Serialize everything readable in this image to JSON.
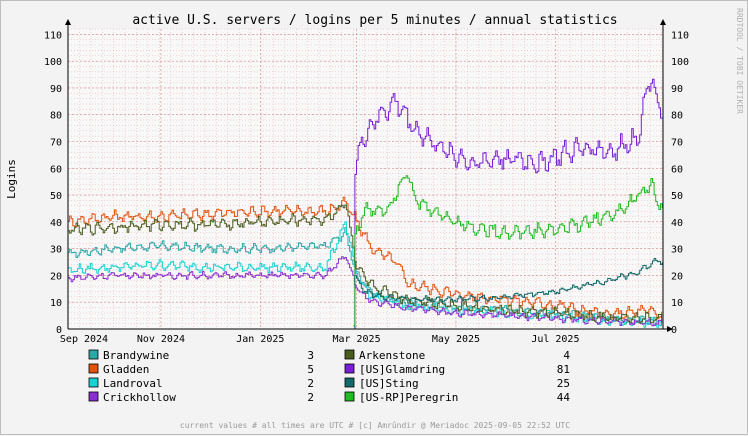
{
  "chart_data": {
    "type": "line",
    "title": "active U.S. servers / logins per 5 minutes / annual statistics",
    "ylabel": "Logins",
    "right_label": "RRDTOOL / TOBI OETIKER",
    "footer": "current values # all times are UTC # [c] Amrûndir @ Meriadoc 2025-09-05 22:52 UTC",
    "ylim": [
      0,
      112
    ],
    "y_ticks": [
      0,
      10,
      20,
      30,
      40,
      50,
      60,
      70,
      80,
      90,
      100,
      110
    ],
    "x_range": [
      "2024-09-05",
      "2025-09-05"
    ],
    "x_ticks": [
      {
        "date": "2024-09-01",
        "label": "Sep 2024"
      },
      {
        "date": "2024-11-01",
        "label": "Nov 2024"
      },
      {
        "date": "2025-01-01",
        "label": "Jan 2025"
      },
      {
        "date": "2025-03-01",
        "label": "Mar 2025"
      },
      {
        "date": "2025-05-01",
        "label": "May 2025"
      },
      {
        "date": "2025-07-01",
        "label": "Jul 2025"
      }
    ],
    "grid": true,
    "legend_position": "bottom",
    "series": [
      {
        "name": "Brandywine",
        "current": "3",
        "color": "#2aa7a7",
        "points": [
          [
            "2024-09-05",
            28
          ],
          [
            "2024-10-01",
            30
          ],
          [
            "2024-11-01",
            31
          ],
          [
            "2024-12-01",
            30
          ],
          [
            "2025-01-01",
            30
          ],
          [
            "2025-02-10",
            31
          ],
          [
            "2025-02-22",
            36
          ],
          [
            "2025-03-01",
            20
          ],
          [
            "2025-03-10",
            14
          ],
          [
            "2025-03-20",
            11
          ],
          [
            "2025-04-01",
            9
          ],
          [
            "2025-05-01",
            8
          ],
          [
            "2025-06-01",
            7
          ],
          [
            "2025-07-01",
            6
          ],
          [
            "2025-08-01",
            4
          ],
          [
            "2025-09-05",
            3
          ]
        ]
      },
      {
        "name": "Gladden",
        "current": "5",
        "color": "#e2530e",
        "points": [
          [
            "2024-09-05",
            40
          ],
          [
            "2024-10-01",
            42
          ],
          [
            "2024-11-01",
            42
          ],
          [
            "2024-12-01",
            43
          ],
          [
            "2025-01-01",
            44
          ],
          [
            "2025-02-10",
            44
          ],
          [
            "2025-02-22",
            47
          ],
          [
            "2025-03-01",
            40
          ],
          [
            "2025-03-10",
            30
          ],
          [
            "2025-03-25",
            25
          ],
          [
            "2025-04-01",
            17
          ],
          [
            "2025-05-01",
            13
          ],
          [
            "2025-06-01",
            11
          ],
          [
            "2025-07-01",
            9
          ],
          [
            "2025-08-01",
            5
          ],
          [
            "2025-08-25",
            7
          ],
          [
            "2025-09-05",
            5
          ]
        ]
      },
      {
        "name": "Landroval",
        "current": "2",
        "color": "#16d2d2",
        "points": [
          [
            "2024-09-05",
            22
          ],
          [
            "2024-10-01",
            23
          ],
          [
            "2024-11-01",
            24
          ],
          [
            "2024-12-01",
            23
          ],
          [
            "2025-01-01",
            23
          ],
          [
            "2025-02-10",
            23
          ],
          [
            "2025-02-22",
            40
          ],
          [
            "2025-03-01",
            19
          ],
          [
            "2025-03-10",
            12
          ],
          [
            "2025-04-01",
            9
          ],
          [
            "2025-05-01",
            7
          ],
          [
            "2025-06-01",
            6
          ],
          [
            "2025-07-01",
            5
          ],
          [
            "2025-08-01",
            3
          ],
          [
            "2025-09-05",
            2
          ]
        ]
      },
      {
        "name": "Crickhollow",
        "current": "2",
        "color": "#8b2fd0",
        "points": [
          [
            "2024-09-05",
            19
          ],
          [
            "2024-10-01",
            20
          ],
          [
            "2024-11-01",
            20
          ],
          [
            "2024-12-01",
            20
          ],
          [
            "2025-01-01",
            20
          ],
          [
            "2025-02-10",
            20
          ],
          [
            "2025-02-22",
            28
          ],
          [
            "2025-03-01",
            15
          ],
          [
            "2025-03-10",
            10
          ],
          [
            "2025-04-01",
            8
          ],
          [
            "2025-05-01",
            6
          ],
          [
            "2025-06-01",
            5
          ],
          [
            "2025-07-01",
            4
          ],
          [
            "2025-08-01",
            3
          ],
          [
            "2025-09-05",
            2
          ]
        ]
      },
      {
        "name": "Arkenstone",
        "current": "4",
        "color": "#4a5c1f",
        "points": [
          [
            "2024-09-05",
            37
          ],
          [
            "2024-10-01",
            38
          ],
          [
            "2024-11-01",
            39
          ],
          [
            "2024-12-01",
            39
          ],
          [
            "2025-01-01",
            40
          ],
          [
            "2025-02-10",
            41
          ],
          [
            "2025-02-22",
            47
          ],
          [
            "2025-03-01",
            22
          ],
          [
            "2025-03-10",
            16
          ],
          [
            "2025-04-01",
            11
          ],
          [
            "2025-05-01",
            9
          ],
          [
            "2025-06-01",
            7
          ],
          [
            "2025-07-01",
            6
          ],
          [
            "2025-08-01",
            4
          ],
          [
            "2025-09-05",
            4
          ]
        ]
      },
      {
        "name": "[US]Glamdring",
        "current": "81",
        "color": "#7a1ed8",
        "points": [
          [
            "2025-02-27",
            0
          ],
          [
            "2025-02-28",
            60
          ],
          [
            "2025-03-05",
            72
          ],
          [
            "2025-03-15",
            80
          ],
          [
            "2025-03-25",
            85
          ],
          [
            "2025-04-05",
            75
          ],
          [
            "2025-04-20",
            68
          ],
          [
            "2025-05-10",
            62
          ],
          [
            "2025-06-01",
            64
          ],
          [
            "2025-06-20",
            62
          ],
          [
            "2025-07-05",
            65
          ],
          [
            "2025-07-20",
            68
          ],
          [
            "2025-08-05",
            66
          ],
          [
            "2025-08-20",
            72
          ],
          [
            "2025-08-28",
            95
          ],
          [
            "2025-09-02",
            84
          ],
          [
            "2025-09-05",
            81
          ]
        ]
      },
      {
        "name": "[US]Sting",
        "current": "25",
        "color": "#136a6a",
        "points": [
          [
            "2025-02-27",
            0
          ],
          [
            "2025-02-28",
            20
          ],
          [
            "2025-03-05",
            14
          ],
          [
            "2025-03-15",
            12
          ],
          [
            "2025-04-01",
            11
          ],
          [
            "2025-05-01",
            11
          ],
          [
            "2025-06-01",
            12
          ],
          [
            "2025-07-01",
            14
          ],
          [
            "2025-08-01",
            18
          ],
          [
            "2025-08-20",
            21
          ],
          [
            "2025-09-01",
            26
          ],
          [
            "2025-09-05",
            25
          ]
        ]
      },
      {
        "name": "[US-RP]Peregrin",
        "current": "44",
        "color": "#23bb23",
        "points": [
          [
            "2025-02-27",
            0
          ],
          [
            "2025-02-28",
            35
          ],
          [
            "2025-03-05",
            44
          ],
          [
            "2025-03-20",
            45
          ],
          [
            "2025-04-01",
            60
          ],
          [
            "2025-04-05",
            48
          ],
          [
            "2025-04-20",
            43
          ],
          [
            "2025-05-10",
            38
          ],
          [
            "2025-06-01",
            36
          ],
          [
            "2025-07-01",
            37
          ],
          [
            "2025-07-20",
            40
          ],
          [
            "2025-08-10",
            44
          ],
          [
            "2025-08-28",
            54
          ],
          [
            "2025-09-05",
            44
          ]
        ]
      }
    ]
  }
}
